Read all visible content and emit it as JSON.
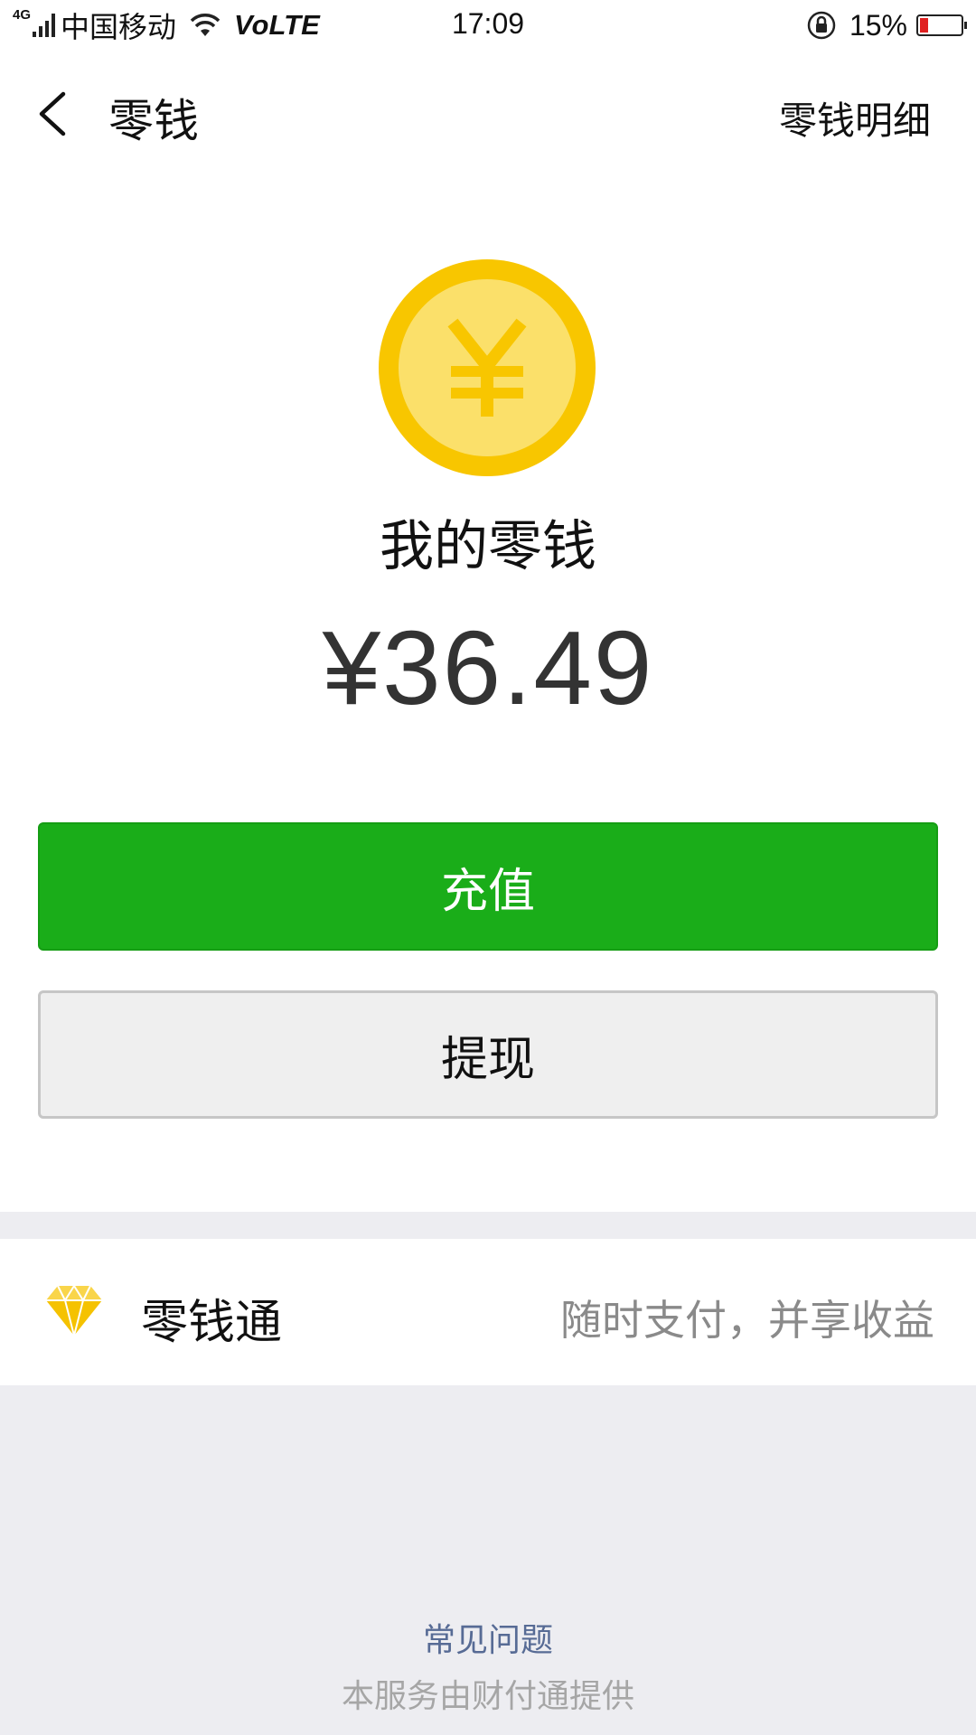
{
  "status_bar": {
    "network": "4G",
    "carrier": "中国移动",
    "volte": "VoLTE",
    "time": "17:09",
    "battery": "15%"
  },
  "nav": {
    "title": "零钱",
    "detail_link": "零钱明细"
  },
  "wallet": {
    "coin_symbol": "¥",
    "label": "我的零钱",
    "balance": "¥36.49"
  },
  "actions": {
    "topup_label": "充值",
    "withdraw_label": "提现"
  },
  "lingqiantong": {
    "title": "零钱通",
    "description": "随时支付，并享收益"
  },
  "footer": {
    "faq_link": "常见问题",
    "provider_text": "本服务由财付通提供"
  },
  "colors": {
    "primary_green": "#1aad19",
    "coin_outer": "#f8c600",
    "coin_inner": "#fbe06a",
    "link_blue": "#576b95",
    "battery_low": "#e02020"
  },
  "icons": {
    "back": "chevron-left-icon",
    "coin": "yuan-coin-icon",
    "lingqiantong": "diamond-icon",
    "wifi": "wifi-icon",
    "rotation_lock": "rotation-lock-icon"
  }
}
